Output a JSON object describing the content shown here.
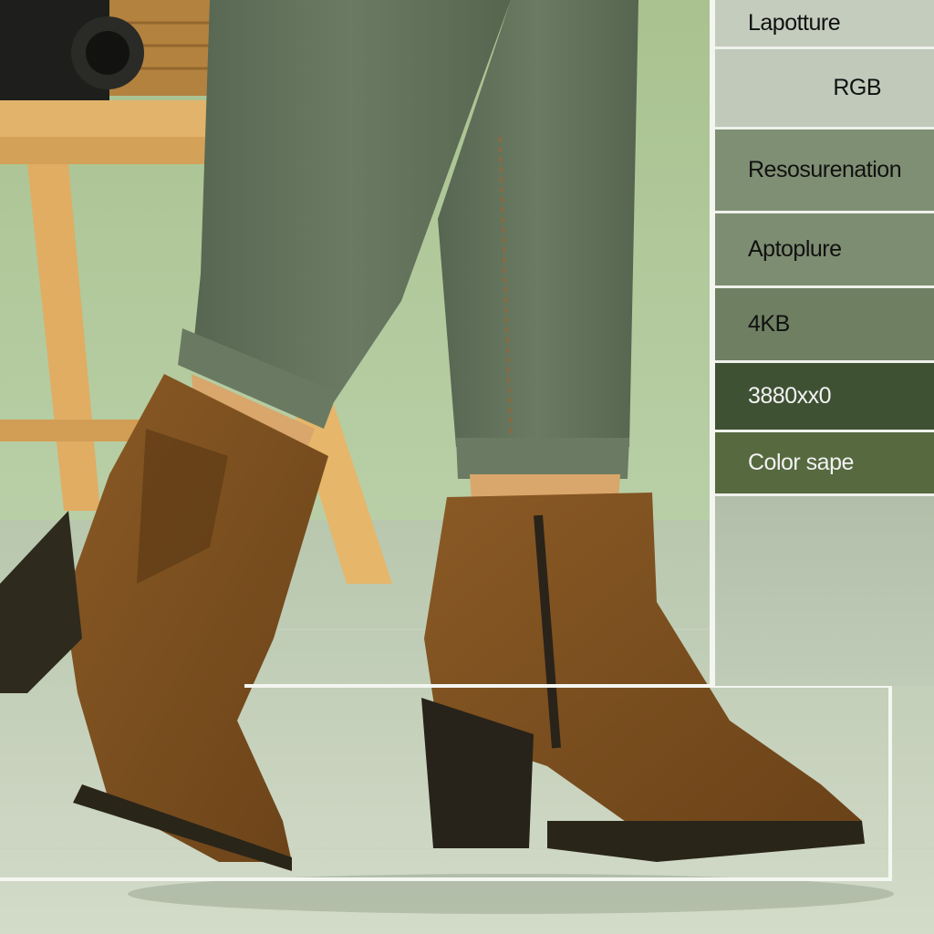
{
  "meta_panel": {
    "rows": [
      {
        "label": "Lapotture"
      },
      {
        "label": "RGB"
      },
      {
        "label": "Resosurenation"
      },
      {
        "label": "Aptoplure"
      },
      {
        "label": "4KB"
      },
      {
        "label": "3880xx0"
      },
      {
        "label": "Color sape"
      }
    ]
  },
  "colors": {
    "wall": "#b9cda4",
    "floor": "#c5cfb9",
    "jeans": "#5f6f57",
    "boot": "#7a5020",
    "panel_dark": "#3f5133"
  }
}
